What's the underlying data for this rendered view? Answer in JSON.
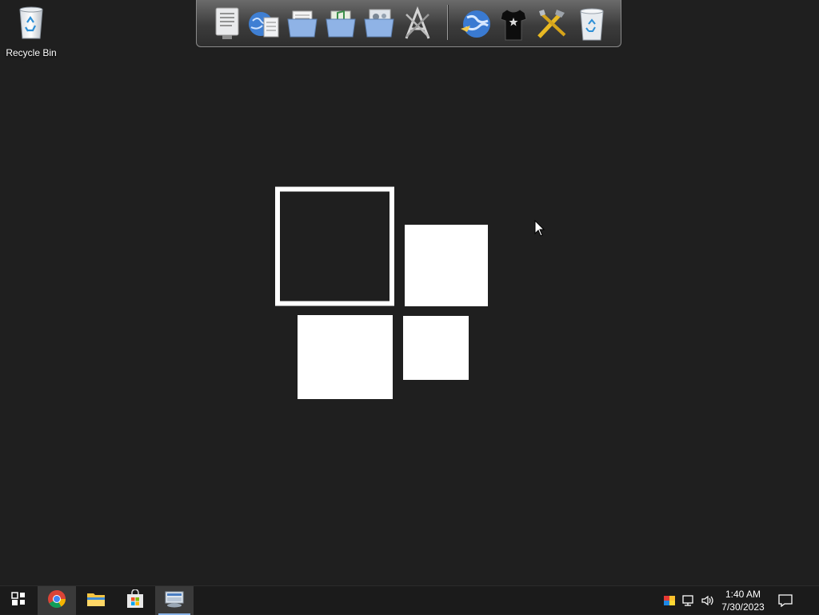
{
  "desktop": {
    "icons": [
      {
        "label": "Recycle Bin",
        "icon": "recycle-bin-icon"
      }
    ],
    "background_color": "#1f1f1f"
  },
  "dock": {
    "items": [
      {
        "icon": "text-editor-icon"
      },
      {
        "icon": "web-document-icon"
      },
      {
        "icon": "documents-folder-icon"
      },
      {
        "icon": "music-folder-icon"
      },
      {
        "icon": "pictures-folder-icon"
      },
      {
        "icon": "applications-icon"
      },
      {
        "icon": "globe-browser-icon"
      },
      {
        "icon": "tshirt-theme-icon"
      },
      {
        "icon": "tools-icon"
      },
      {
        "icon": "trash-icon"
      }
    ]
  },
  "taskbar": {
    "apps": [
      {
        "icon": "task-view-icon"
      },
      {
        "icon": "chrome-icon"
      },
      {
        "icon": "file-explorer-icon"
      },
      {
        "icon": "microsoft-store-icon"
      },
      {
        "icon": "dock-app-icon"
      }
    ],
    "tray": {
      "icons": [
        "color-app-icon",
        "network-icon",
        "volume-icon"
      ],
      "time": "1:40 AM",
      "date": "7/30/2023",
      "notification_icon": "notification-icon"
    }
  }
}
